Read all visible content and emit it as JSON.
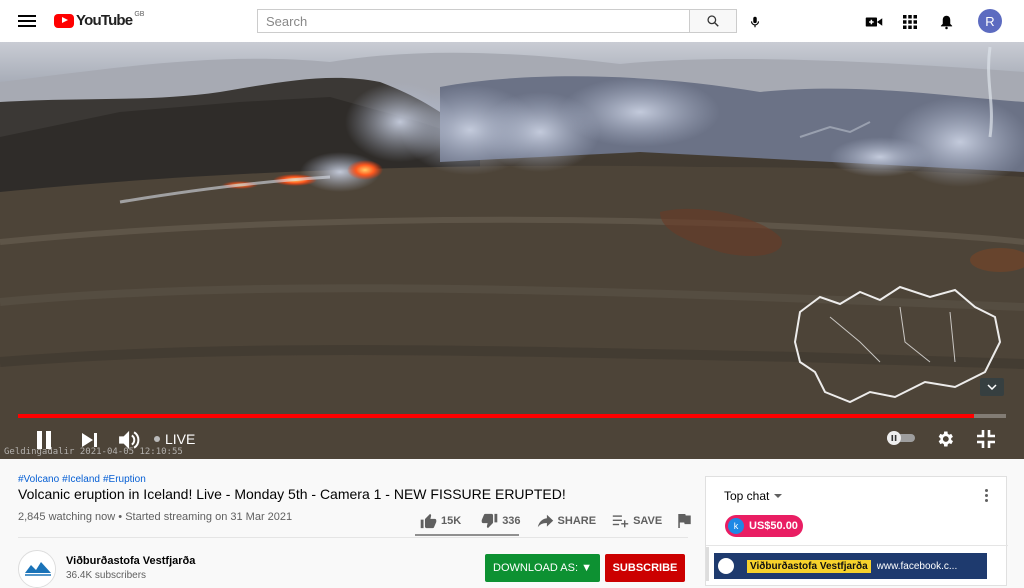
{
  "header": {
    "logo_text": "YouTube",
    "logo_country": "GB",
    "search_placeholder": "Search",
    "avatar_letter": "R",
    "icons": [
      "menu-icon",
      "search-icon",
      "mic-icon",
      "create-video-icon",
      "apps-grid-icon",
      "notifications-bell-icon"
    ]
  },
  "player": {
    "live_label": "LIVE",
    "progress": 0.968,
    "overlay_timestamp": "Geldingadalir 2021-04-05 12:10:55",
    "controls": [
      "pause-icon",
      "next-icon",
      "volume-icon",
      "autoplay-toggle",
      "settings-gear-icon",
      "exit-fullscreen-icon"
    ]
  },
  "video": {
    "hashtags": [
      "#Volcano",
      "#Iceland",
      "#Eruption"
    ],
    "title": "Volcanic eruption in Iceland! Live - Monday 5th - Camera 1 - NEW FISSURE ERUPTED!",
    "watching": "2,845 watching now",
    "started": "Started streaming on 31 Mar 2021",
    "likes": "15K",
    "dislikes": "336",
    "share_label": "SHARE",
    "save_label": "SAVE"
  },
  "channel": {
    "name": "Viðburðastofa Vestfjarða",
    "subscribers": "36.4K subscribers",
    "download_label": "DOWNLOAD AS: ▼",
    "subscribe_label": "SUBSCRIBE"
  },
  "chat": {
    "header": "Top chat",
    "superchat_initial": "k",
    "superchat_amount": "US$50.00",
    "pinned_author": "Viðburðastofa Vestfjarða",
    "pinned_message": "www.facebook.c..."
  },
  "colors": {
    "brand_red": "#ff0000",
    "progress_red": "#ff0000",
    "subscribe_red": "#cc0000",
    "download_green": "#0d9132",
    "superchat_pink": "#e91e63",
    "link_blue": "#065fd4"
  }
}
